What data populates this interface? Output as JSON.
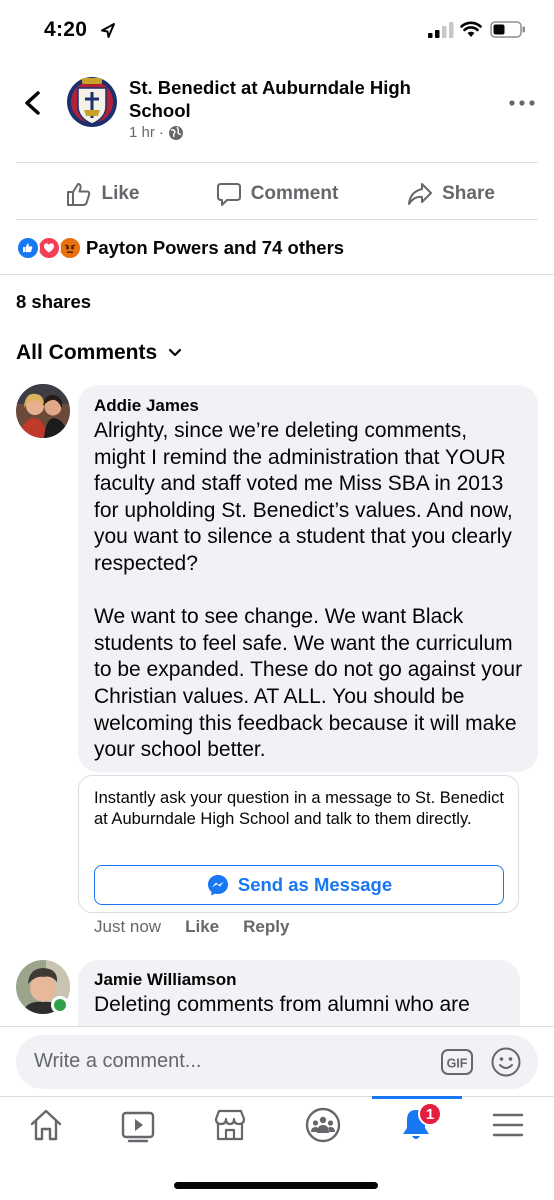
{
  "status_bar": {
    "time": "4:20"
  },
  "header": {
    "page_name": "St. Benedict at Auburndale High School",
    "post_time": "1 hr",
    "meta_separator": "·"
  },
  "actions": {
    "like": "Like",
    "comment": "Comment",
    "share": "Share"
  },
  "reactions": {
    "text": "Payton Powers and 74 others"
  },
  "shares": "8 shares",
  "comments_filter": "All Comments",
  "comments": [
    {
      "author": "Addie James",
      "text": "Alrighty, since we’re deleting comments, might I remind the administration that YOUR faculty and staff voted me Miss SBA in 2013 for upholding St. Benedict’s values. And now, you want to silence a student that you clearly respected?\n\nWe want to see change. We want Black students to feel safe. We want the curriculum to be expanded. These do not go against your Christian values. AT ALL. You should be welcoming this feedback because it will make your school better.",
      "time": "Just now",
      "like": "Like",
      "reply": "Reply"
    },
    {
      "author": "Jamie Williamson",
      "text": "Deleting comments from alumni who are"
    }
  ],
  "message_prompt": {
    "text": "Instantly ask your question in a message to St. Benedict at Auburndale High School and talk to them directly.",
    "button": "Send as Message"
  },
  "composer": {
    "placeholder": "Write a comment...",
    "gif": "GIF"
  },
  "tabbar": {
    "notifications_badge": "1"
  },
  "colors": {
    "accent": "#1877f2",
    "secondary_text": "#65676b",
    "bubble": "#f0f2f5",
    "badge": "#e41e3f",
    "online": "#31a24c"
  }
}
